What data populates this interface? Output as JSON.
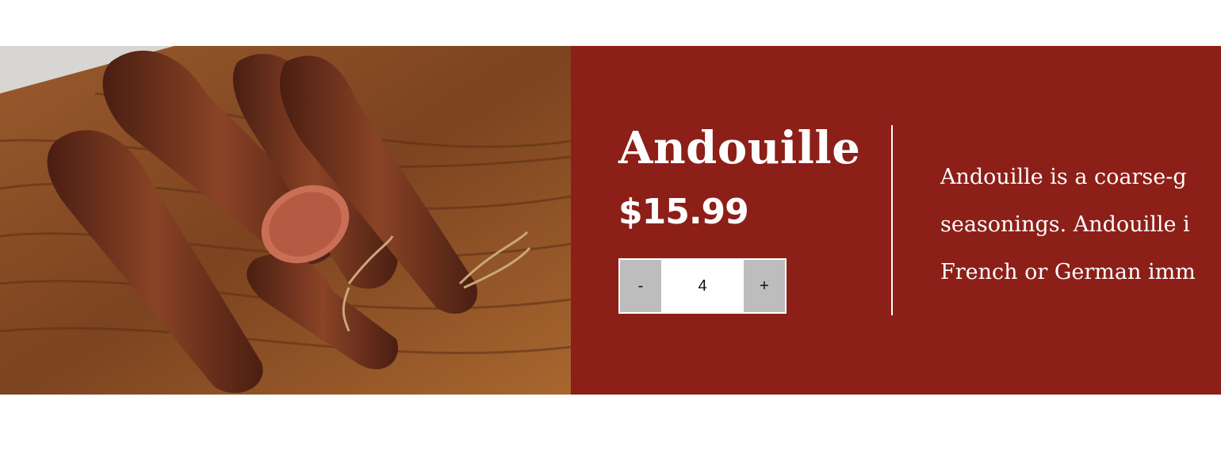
{
  "product": {
    "name": "Andouille",
    "price": "$15.99",
    "quantity": {
      "decrement_label": "-",
      "value": "4",
      "increment_label": "+"
    },
    "description_lines": [
      "Andouille is a coarse-g",
      "seasonings. Andouille i",
      "French or German imm"
    ],
    "image_icon": "andouille-sausages-on-cutting-board-photo"
  },
  "colors": {
    "panel_background": "#8c1f18",
    "text": "#ffffff",
    "stepper_button": "#bdbdbd"
  }
}
